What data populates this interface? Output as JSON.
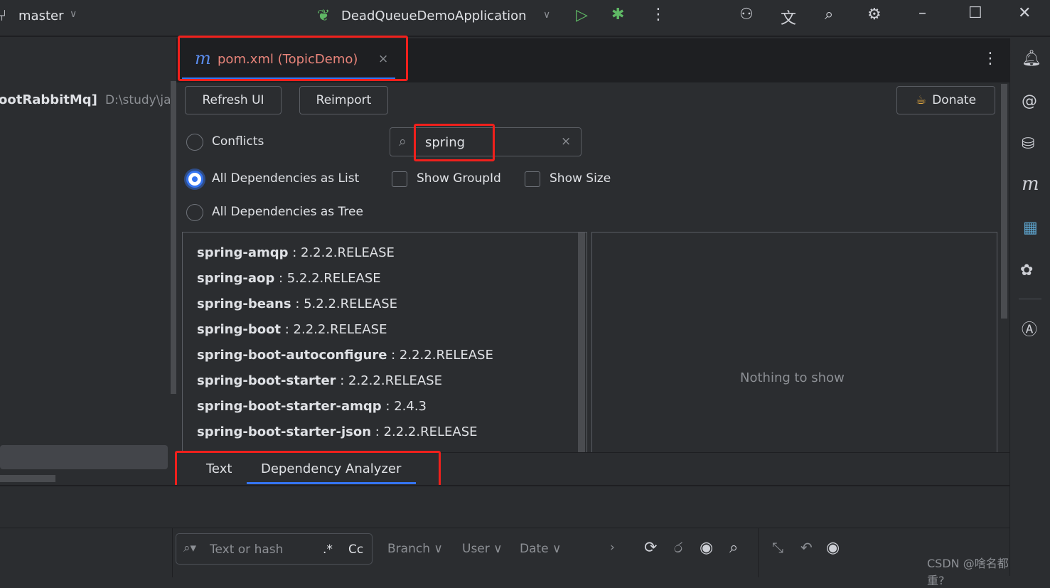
{
  "titlebar": {
    "branch": "master",
    "run_config": "DeadQueueDemoApplication"
  },
  "project": {
    "name": "ootRabbitMq]",
    "path": "D:\\study\\jav"
  },
  "tab": {
    "label": "pom.xml (TopicDemo)",
    "icon": "m"
  },
  "toolbar": {
    "refresh": "Refresh UI",
    "reimport": "Reimport",
    "donate": "Donate"
  },
  "options": {
    "conflicts": "Conflicts",
    "as_list": "All Dependencies as List",
    "as_tree": "All Dependencies as Tree",
    "show_groupid": "Show GroupId",
    "show_size": "Show Size",
    "selected": "as_list"
  },
  "search": {
    "value": "spring"
  },
  "dependencies": [
    {
      "name": "spring-amqp",
      "version": " : 2.2.2.RELEASE"
    },
    {
      "name": "spring-aop",
      "version": " : 5.2.2.RELEASE"
    },
    {
      "name": "spring-beans",
      "version": " : 5.2.2.RELEASE"
    },
    {
      "name": "spring-boot",
      "version": " : 2.2.2.RELEASE"
    },
    {
      "name": "spring-boot-autoconfigure",
      "version": " : 2.2.2.RELEASE"
    },
    {
      "name": "spring-boot-starter",
      "version": " : 2.2.2.RELEASE"
    },
    {
      "name": "spring-boot-starter-amqp",
      "version": " : 2.4.3"
    },
    {
      "name": "spring-boot-starter-json",
      "version": " : 2.2.2.RELEASE"
    }
  ],
  "detail": {
    "empty": "Nothing to show"
  },
  "bottom_tabs": [
    {
      "label": "Text"
    },
    {
      "label": "Dependency Analyzer",
      "active": true
    }
  ],
  "vcs": {
    "placeholder": "Text or hash",
    "regex": ".*",
    "case": "Cc",
    "branch": "Branch",
    "user": "User",
    "date": "Date"
  },
  "watermark": "CSDN @啥名都重?",
  "colors": {
    "accent": "#3574f0",
    "highlight": "#f0201c",
    "tab_text": "#e8847a"
  }
}
